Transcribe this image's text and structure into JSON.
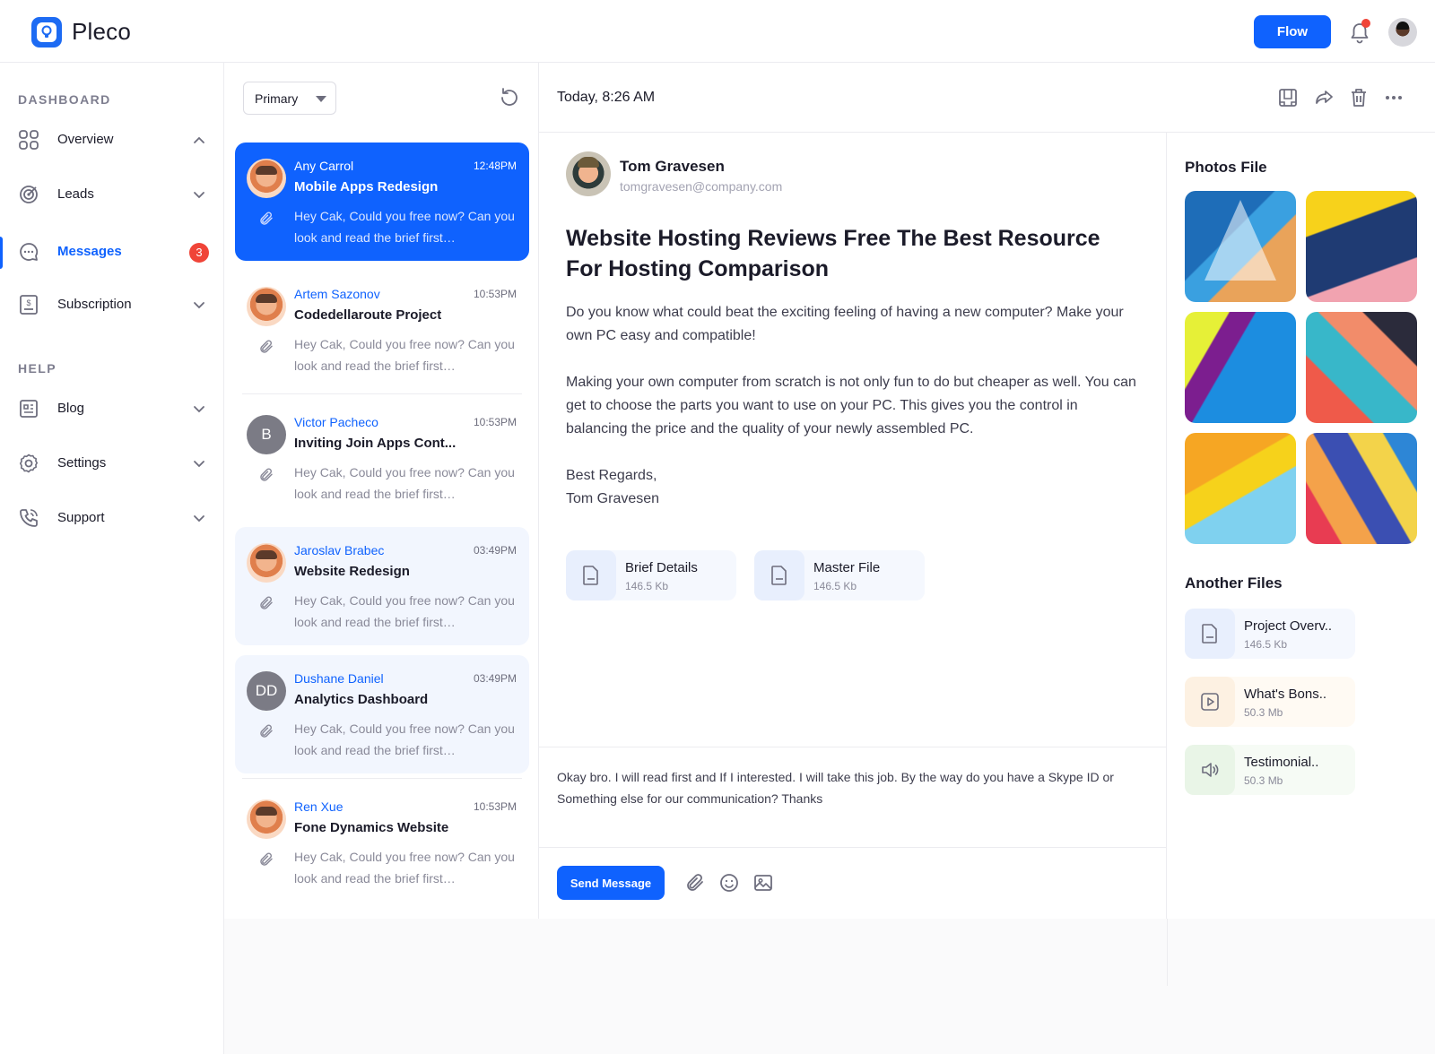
{
  "app": {
    "name": "Pleco"
  },
  "header": {
    "flow_label": "Flow"
  },
  "sidebar": {
    "section_dashboard": "DASHBOARD",
    "section_help": "HELP",
    "items": [
      {
        "label": "Overview",
        "icon": "grid-icon"
      },
      {
        "label": "Leads",
        "icon": "target-icon"
      },
      {
        "label": "Messages",
        "icon": "chat-icon",
        "badge": "3"
      },
      {
        "label": "Subscription",
        "icon": "invoice-icon"
      },
      {
        "label": "Blog",
        "icon": "blog-icon"
      },
      {
        "label": "Settings",
        "icon": "gear-icon"
      },
      {
        "label": "Support",
        "icon": "phone-icon"
      }
    ]
  },
  "inbox": {
    "filter_value": "Primary",
    "messages": [
      {
        "name": "Any Carrol",
        "time": "12:48PM",
        "subject": "Mobile Apps Redesign",
        "preview": "Hey Cak, Could you free now? Can you look and read the brief first…"
      },
      {
        "name": "Artem Sazonov",
        "time": "10:53PM",
        "subject": "Codedellaroute Project",
        "preview": "Hey Cak, Could you free now? Can you look and read the brief first…"
      },
      {
        "name": "Victor Pacheco",
        "initials": "B",
        "time": "10:53PM",
        "subject": "Inviting Join Apps Cont...",
        "preview": "Hey Cak, Could you free now? Can you look and read the brief first…"
      },
      {
        "name": "Jaroslav Brabec",
        "time": "03:49PM",
        "subject": "Website Redesign",
        "preview": "Hey Cak, Could you free now? Can you look and read the brief first…"
      },
      {
        "name": "Dushane Daniel",
        "initials": "DD",
        "time": "03:49PM",
        "subject": "Analytics Dashboard",
        "preview": "Hey Cak, Could you free now? Can you look and read the brief first…"
      },
      {
        "name": "Ren Xue",
        "time": "10:53PM",
        "subject": "Fone Dynamics Website",
        "preview": "Hey Cak, Could you free now? Can you look and read the brief first…"
      }
    ]
  },
  "detail": {
    "date": "Today, 8:26 AM",
    "sender_name": "Tom Gravesen",
    "sender_email": "tomgravesen@company.com",
    "subject": "Website Hosting Reviews Free The Best Resource For Hosting Comparison",
    "paragraph_1": "Do you know what could beat the exciting feeling of having a new computer? Make your own PC easy and compatible!",
    "paragraph_2": "Making your own computer from scratch is not only fun to do but cheaper as well. You can get to choose the parts you want to use on your PC. This gives you the control in balancing the price and the quality of your newly assembled PC.",
    "regards": "Best Regards,",
    "signature": "Tom Gravesen",
    "attachments": [
      {
        "name": "Brief Details",
        "size": "146.5 Kb"
      },
      {
        "name": "Master File",
        "size": "146.5 Kb"
      }
    ],
    "reply_text": "Okay bro. I will read first and If I interested. I will take this job. By the way do you have a Skype ID or Something else for our communication? Thanks",
    "send_label": "Send Message"
  },
  "side_panel": {
    "photos_title": "Photos File",
    "files_title": "Another Files",
    "files": [
      {
        "name": "Project Overv..",
        "size": "146.5 Kb",
        "icon": "document-icon"
      },
      {
        "name": "What's Bons..",
        "size": "50.3 Mb",
        "icon": "video-icon"
      },
      {
        "name": "Testimonial..",
        "size": "50.3 Mb",
        "icon": "audio-icon"
      }
    ]
  },
  "colors": {
    "accent": "#0f62fe",
    "badge": "#f04438",
    "text": "#1b1b29"
  }
}
